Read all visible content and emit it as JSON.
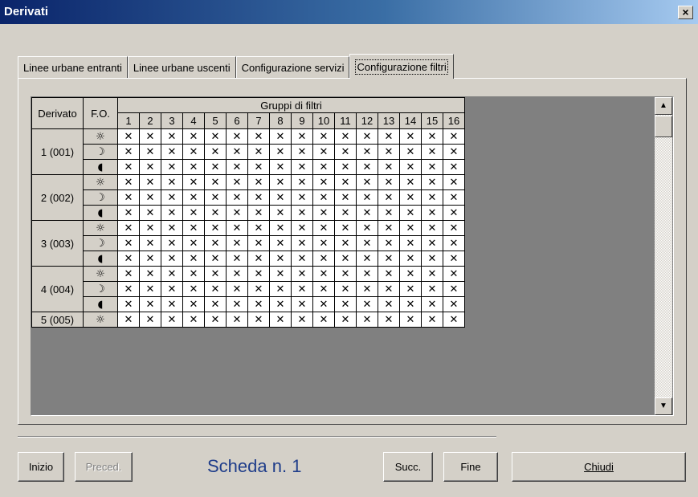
{
  "window": {
    "title": "Derivati",
    "close_label": "×"
  },
  "tabs": [
    {
      "label": "Linee urbane entranti",
      "active": false
    },
    {
      "label": "Linee urbane uscenti",
      "active": false
    },
    {
      "label": "Configurazione servizi",
      "active": false
    },
    {
      "label": "Configurazione filtri",
      "active": true
    }
  ],
  "grid": {
    "col_derivato": "Derivato",
    "col_fo": "F.O.",
    "group_header": "Gruppi di filtri",
    "groups": [
      "1",
      "2",
      "3",
      "4",
      "5",
      "6",
      "7",
      "8",
      "9",
      "10",
      "11",
      "12",
      "13",
      "14",
      "15",
      "16"
    ],
    "cell_mark": "✕",
    "fo_icons": [
      {
        "name": "sun-icon",
        "glyph": "☼"
      },
      {
        "name": "moon-icon",
        "glyph": "☽"
      },
      {
        "name": "half-moon-icon",
        "glyph": "◖"
      }
    ],
    "rows": [
      {
        "label": "1 (001)",
        "slots": 3
      },
      {
        "label": "2 (002)",
        "slots": 3
      },
      {
        "label": "3 (003)",
        "slots": 3
      },
      {
        "label": "4 (004)",
        "slots": 3
      },
      {
        "label": "5 (005)",
        "slots": 1
      }
    ]
  },
  "scrollbar": {
    "up_label": "▲",
    "down_label": "▼"
  },
  "footer": {
    "inizio_label": "Inizio",
    "preced_label": "Preced.",
    "scheda_label": "Scheda n. 1",
    "succ_label": "Succ.",
    "fine_label": "Fine",
    "chiudi_label": "Chiudi"
  }
}
